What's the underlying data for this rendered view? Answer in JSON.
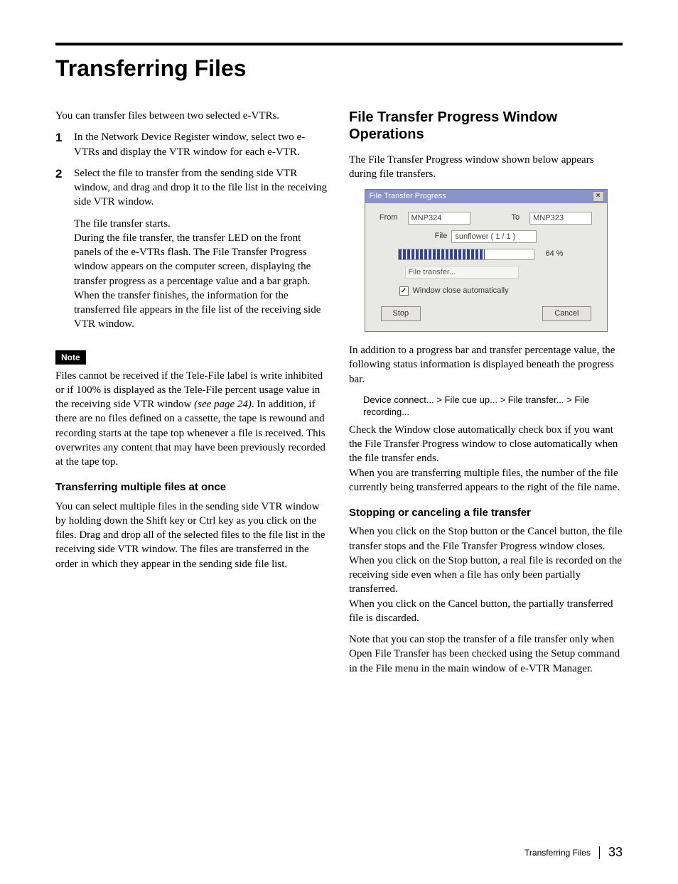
{
  "page": {
    "title": "Transferring Files",
    "footer_label": "Transferring Files",
    "page_number": "33"
  },
  "left": {
    "intro": "You can transfer files between two selected e-VTRs.",
    "step1_num": "1",
    "step1": "In the Network Device Register window, select two e-VTRs and display the VTR window for each e-VTR.",
    "step2_num": "2",
    "step2a": "Select the file to transfer from the sending side VTR window, and drag and drop it to the file list in the receiving side VTR window.",
    "step2b": "The file transfer starts.",
    "step2c": "During the file transfer, the transfer LED on the front panels of the e-VTRs flash. The File Transfer Progress window appears on the computer screen, displaying the transfer progress as a percentage value and a bar graph.",
    "step2d": "When the transfer finishes, the information for the transferred file appears in the file list of the receiving side VTR window.",
    "note_label": "Note",
    "note_body_a": "Files cannot be received if the Tele-File label is write inhibited or if 100% is displayed as the Tele-File percent usage value in the receiving side VTR window ",
    "note_body_ref": "(see page 24)",
    "note_body_b": ". In addition, if there are no files defined on a cassette, the tape is rewound and recording starts at the tape top whenever a file is received. This overwrites any content that may have been previously recorded at the tape top.",
    "multi_heading": "Transferring multiple files at once",
    "multi_body": "You can select multiple files in the sending side VTR window by holding down the Shift key or Ctrl key as you click on the files. Drag and drop all of the selected files to the file list in the receiving side VTR window. The files are transferred in the order in which they appear in the sending side file list."
  },
  "right": {
    "heading": "File Transfer Progress Window Operations",
    "intro": "The File Transfer Progress window shown below appears during file transfers.",
    "after_fig": "In addition to a progress bar and transfer percentage value, the following status information is displayed beneath the progress bar.",
    "status_sequence": "Device connect... > File cue up... > File transfer... > File recording...",
    "para2a": "Check the Window close automatically check box if you want the File Transfer Progress window to close automatically when the file transfer ends.",
    "para2b": "When you are transferring multiple files, the number of the file currently being transferred appears to the right of the file name.",
    "stop_heading": "Stopping or canceling a file transfer",
    "stop_p1": "When you click on the Stop button or the Cancel button, the file transfer stops and the File Transfer Progress window closes.",
    "stop_p2": "When you click on the Stop button, a real file is recorded on the receiving side even when a file has only been partially transferred.",
    "stop_p3": "When you click on the Cancel button, the partially transferred file is discarded.",
    "stop_p4": "Note that you can stop the transfer of a file transfer only when Open File Transfer has been checked using the Setup command in the File menu in the main window of e-VTR Manager."
  },
  "dialog": {
    "title": "File Transfer Progress",
    "from_label": "From",
    "from_value": "MNP324",
    "to_label": "To",
    "to_value": "MNP323",
    "file_label": "File",
    "file_value": "sunflower ( 1 / 1 )",
    "progress_pct_value": 64,
    "progress_pct_text": "64 %",
    "status_text": "File transfer...",
    "checkbox_checked": true,
    "checkbox_label": "Window close automatically",
    "stop_label": "Stop",
    "cancel_label": "Cancel",
    "close_glyph": "×"
  }
}
